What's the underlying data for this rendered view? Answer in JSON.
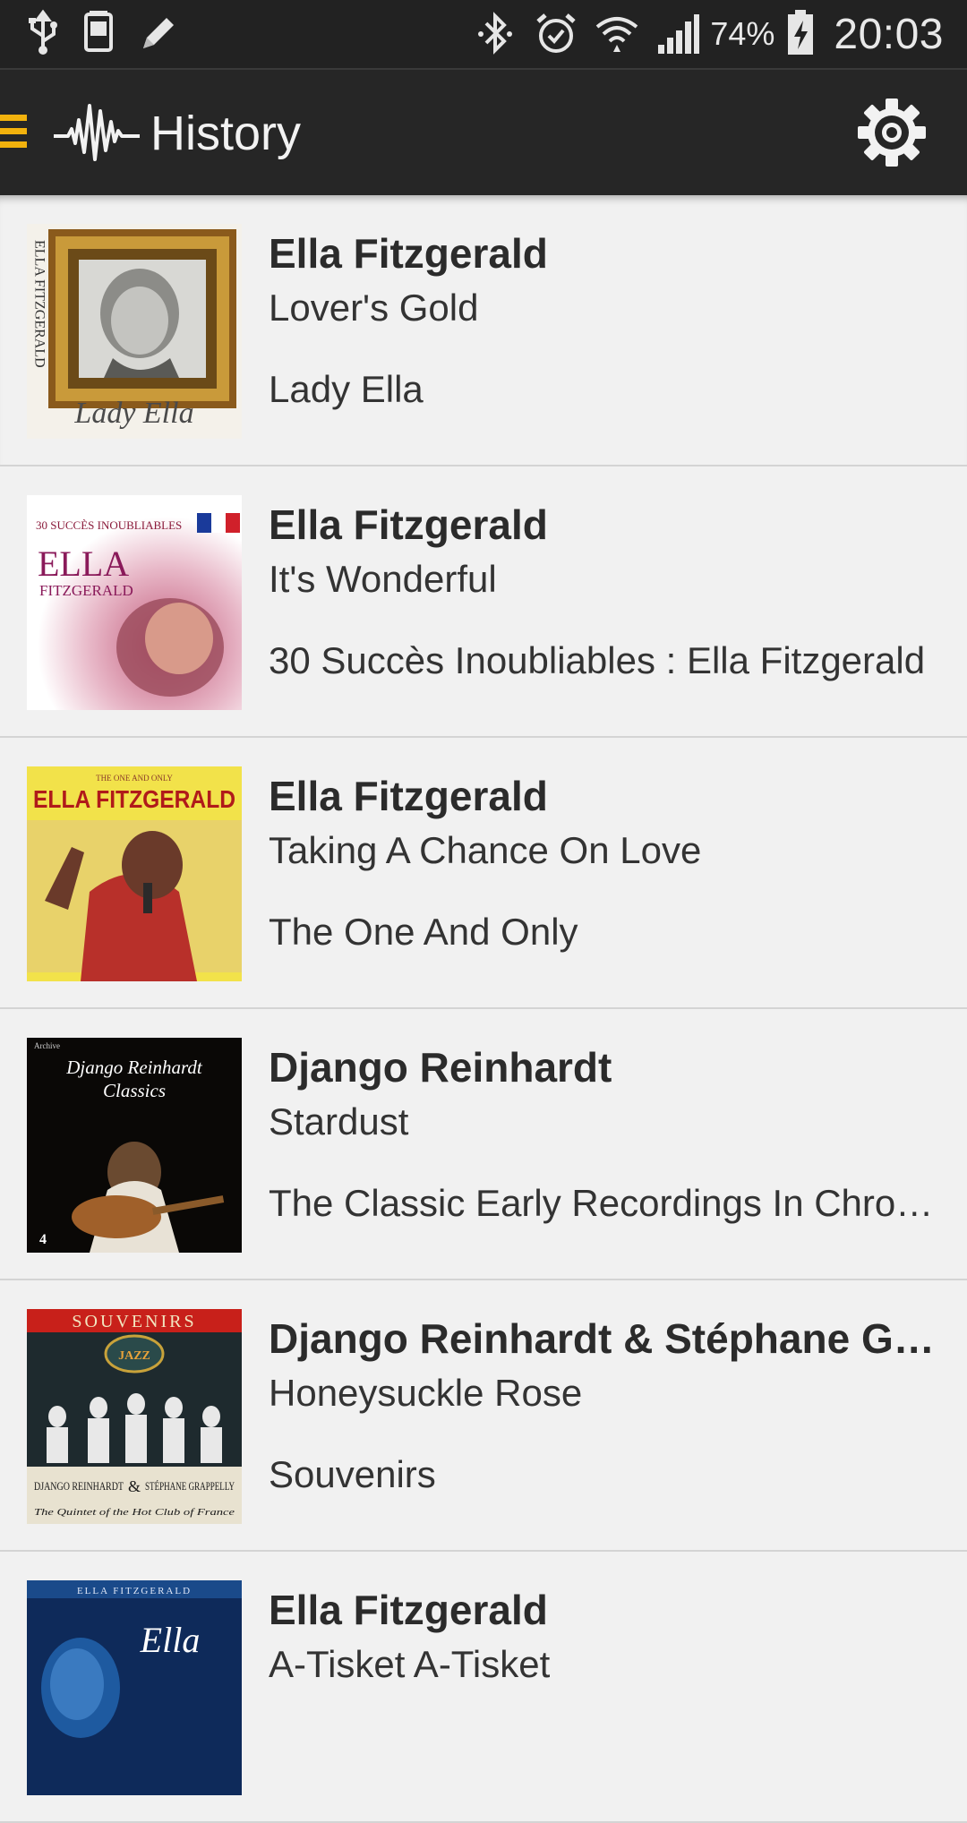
{
  "status_bar": {
    "icons": [
      "usb-icon",
      "screenshot-icon",
      "pencil-icon",
      "bluetooth-icon",
      "alarm-icon",
      "wifi-icon",
      "signal-icon",
      "battery-charging-icon"
    ],
    "battery_percent": "74%",
    "time": "20:03"
  },
  "app_bar": {
    "title": "History",
    "menu_icon": "menu-icon",
    "logo_icon": "waveform-logo-icon",
    "settings_icon": "gear-icon",
    "accent_color": "#f2b20d"
  },
  "history": [
    {
      "artist": "Ella Fitzgerald",
      "song": "Lover's Gold",
      "album": "Lady Ella",
      "cover": {
        "side_text": "ELLA FITZGERALD",
        "script_text": "Lady Ella"
      }
    },
    {
      "artist": "Ella Fitzgerald",
      "song": "It's Wonderful",
      "album": "30 Succès Inoubliables : Ella Fitzgerald",
      "cover": {
        "top_text": "30 SUCCÈS INOUBLIABLES",
        "name_text": "ELLA",
        "sub_text": "FITZGERALD"
      }
    },
    {
      "artist": "Ella Fitzgerald",
      "song": "Taking A Chance On Love",
      "album": "The One And Only",
      "cover": {
        "top_text": "THE ONE AND ONLY",
        "name_text": "ELLA FITZGERALD"
      }
    },
    {
      "artist": "Django Reinhardt",
      "song": "Stardust",
      "album": "The Classic Early Recordings In Chronological Order",
      "cover": {
        "label_text": "Archive",
        "title_line1": "Django Reinhardt",
        "title_line2": "Classics",
        "number": "4"
      }
    },
    {
      "artist": "Django Reinhardt & Stéphane Grappelli",
      "song": "Honeysuckle Rose",
      "album": "Souvenirs",
      "cover": {
        "top_text": "SOUVENIRS",
        "badge_text": "JAZZ",
        "left_name": "DJANGO REINHARDT",
        "right_name": "STÉPHANE GRAPPELLY",
        "amp": "&",
        "bottom_text": "The Quintet of the Hot Club of France"
      }
    },
    {
      "artist": "Ella Fitzgerald",
      "song": "A-Tisket A-Tisket",
      "album": "",
      "cover": {
        "top_text": "ELLA FITZGERALD",
        "script_text": "Ella"
      }
    }
  ]
}
